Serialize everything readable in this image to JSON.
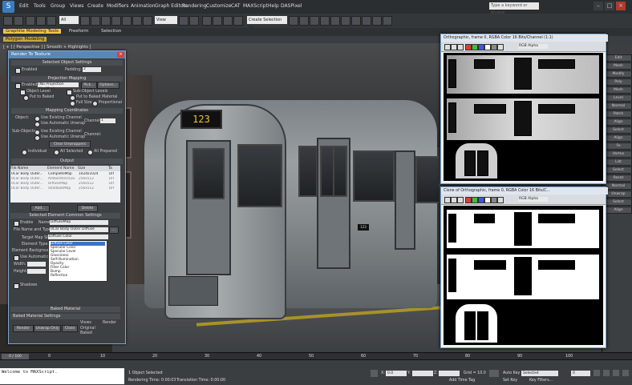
{
  "menubar": {
    "items": [
      "Edit",
      "Tools",
      "Group",
      "Views",
      "Create",
      "Modifiers",
      "Animation",
      "Graph Editors",
      "Rendering",
      "Customize",
      "CAT",
      "MAXScript",
      "Help",
      "DASPixel"
    ],
    "search_placeholder": "Type a keyword or phrase"
  },
  "toolbar": {
    "selection_set": "All",
    "view_dropdown": "View",
    "create_sel_set": "Create Selection Se"
  },
  "ribbon": {
    "tabs": [
      "Graphite Modeling Tools",
      "Freeform",
      "Selection"
    ],
    "active_sub": "Polygon Modeling"
  },
  "viewport": {
    "label": "[ + ] [ Perspective ] [ Smooth + Highlights ]",
    "train_number": "123",
    "side_plate": "123"
  },
  "dialog": {
    "title": "Render To Texture",
    "sections": {
      "selected_object_settings": "Selected Object Settings",
      "projection_mapping": "Projection Mapping",
      "mapping_coordinates": "Mapping Coordinates",
      "output": "Output",
      "common_settings": "Selected Element Common Settings",
      "baked_material": "Baked Material",
      "baked_material_settings": "Baked Material Settings"
    },
    "labels": {
      "enabled": "Enabled",
      "padding": "Padding:",
      "padding_value": "2",
      "proj_enabled": "Enabled",
      "proj_modifier": "(No Projection Modifier)",
      "pick": "Pick...",
      "options": "Options...",
      "object_level": "Object Level",
      "sub_object_levels": "Sub-Object Levels",
      "put_to_baked_1": "Put to Baked",
      "put_to_baked_2": "Put to Baked Material",
      "full_size": "Full Size",
      "proportional": "Proportional",
      "object": "Object:",
      "use_existing_channel": "Use Existing Channel",
      "use_auto_unwrap": "Use Automatic Unwrap",
      "channel": "Channel:",
      "channel_value": "1",
      "sub_objects": "Sub-Objects:",
      "sub_use_existing": "Use Existing Channel",
      "sub_use_auto": "Use Automatic Unwrap",
      "sub_channel": "Channel:",
      "clear_unwrappers": "Clear Unwrappers",
      "individual": "Individual",
      "all_selected": "All Selected",
      "all_prepared": "All Prepared",
      "add": "Add...",
      "delete": "Delete",
      "enable": "Enable",
      "name_label": "Name:",
      "name_value": "DiffuseMap",
      "file_name_type": "File Name and Type:",
      "file_name_value": "0Car Body Outer Diffuse",
      "target_map_slot": "Target Map Slot:",
      "target_map_value": "Diffuse Color",
      "element_type": "Element Type:",
      "element_background": "Element Background:",
      "use_auto_map_size": "Use Automatic Map Size",
      "width": "Width:",
      "height": "Height:",
      "shadows": "Shadows",
      "render": "Render",
      "unwrap_only": "Unwrap Only",
      "close": "Close",
      "views_label": "Views",
      "render_label": "Render",
      "original": "Original",
      "baked": "Baked"
    },
    "output_table": {
      "headers": [
        "File Name",
        "Element Name",
        "Size",
        "Ta"
      ],
      "rows": [
        [
          "0Car Body Outer...",
          "CompleteMap",
          "1024x1024",
          "Dif"
        ],
        [
          "0Car Body Outer...",
          "AmbientOcclusi",
          "256x512",
          "Dif"
        ],
        [
          "0Car Body Outer...",
          "DiffuseMap",
          "256x512",
          "Dif"
        ],
        [
          "0Car Body Outer...",
          "ShadowsMap",
          "256x512",
          "Dif"
        ]
      ]
    },
    "dropdown_options": [
      "Diffuse Color",
      "Specular Color",
      "Specular Level",
      "Glossiness",
      "Self-Illumination",
      "Opacity",
      "Filter Color",
      "Bump",
      "Reflection"
    ]
  },
  "image_window_1": {
    "title": "Orthographic, frame 0, RGBA Color 16 Bits/Channel (1:1)",
    "channel": "RGB Alpha"
  },
  "image_window_2": {
    "title": "Clone of Orthographic, frame 0, RGBA Color 16 Bits/C...",
    "channel": "RGB Alpha"
  },
  "timebar": {
    "position": "0 / 100",
    "ticks": [
      "0",
      "10",
      "20",
      "30",
      "40",
      "50",
      "60",
      "70",
      "80",
      "90",
      "100"
    ]
  },
  "status": {
    "maxscript_text": "Welcome to MAXScript.",
    "selected": "1 Object Selected",
    "rendering_time": "Rendering Time: 0:00:03",
    "translation_time": "Translation Time: 0:00:00",
    "x_label": "X:",
    "x_value": "0.0",
    "y_label": "Y:",
    "z_label": "Z:",
    "grid": "Grid = 10.0",
    "auto_key": "Auto Key",
    "auto_key_value": "Selected",
    "set_key": "Set Key",
    "key_filters": "Key Filters...",
    "add_time_tag": "Add Time Tag",
    "frame": "0"
  },
  "cmdpanel": {
    "items": [
      "Edit",
      "Mesh",
      "Modify",
      "Poly",
      "Mesh",
      "Level",
      "Normal",
      "Patch",
      "Align",
      "Select",
      "Align",
      "Fe",
      "Vertex",
      "List",
      "Select",
      "Reset",
      "Normal",
      "Unwrap",
      "Select",
      "Align"
    ]
  }
}
